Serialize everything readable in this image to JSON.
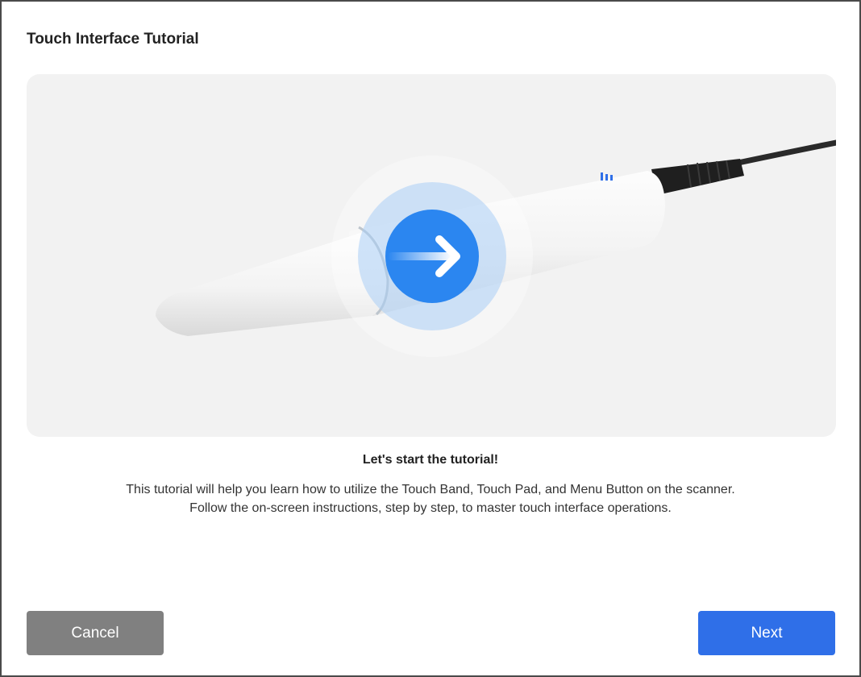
{
  "dialog": {
    "title": "Touch Interface Tutorial",
    "headline": "Let's start the tutorial!",
    "description_line1": "This tutorial will help you learn how to utilize the Touch Band, Touch Pad, and Menu Button on the scanner.",
    "description_line2": "Follow the on-screen instructions, step by step, to master touch interface operations."
  },
  "buttons": {
    "cancel_label": "Cancel",
    "next_label": "Next"
  },
  "illustration": {
    "subject": "intraoral-scanner",
    "gesture_icon": "swipe-right-arrow-icon"
  },
  "colors": {
    "accent": "#2f6fe8",
    "gesture_blue": "#2b86f0",
    "cancel_gray": "#808080"
  }
}
